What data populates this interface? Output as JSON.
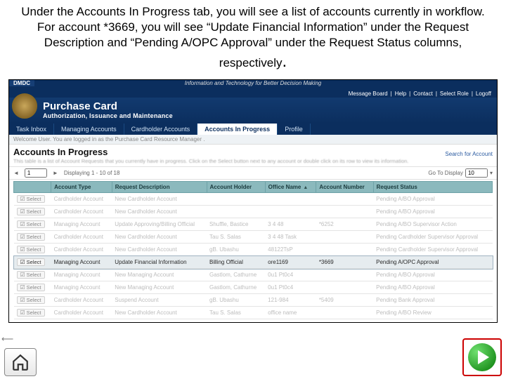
{
  "caption_html": "Under the Accounts In Progress tab, you will see a list of accounts currently in workflow. For account *3669, you will see “Update Financial Information” under the Request Description and “Pending A/OPC Approval” under the Request Status columns, respectively",
  "dmdc": {
    "tag": "DMDC",
    "center": "Information and Technology for Better Decision Making"
  },
  "util": {
    "items": [
      "Message Board",
      "Help",
      "Contact",
      "Select Role",
      "Logoff"
    ],
    "sep": "|"
  },
  "banner": {
    "title": "Purchase Card",
    "sub": "Authorization, Issuance and Maintenance"
  },
  "tabs": [
    "Task Inbox",
    "Managing Accounts",
    "Cardholder Accounts",
    "Accounts In Progress",
    "Profile"
  ],
  "active_tab_index": 3,
  "welcome": "Welcome User.  You are logged in as the Purchase Card Resource Manager .",
  "page_title": "Accounts In Progress",
  "search_link": "Search for Account",
  "instructions": "This table is a list of Account Requests that you currently have in progress.  Click on the Select button next to any account or double click on its row to view its information.",
  "toolbar": {
    "page_field": "1",
    "displaying": "Displaying 1 - 10 of 18",
    "go": "Go To Display",
    "count": "10"
  },
  "columns": [
    "",
    "Account Type",
    "Request Description",
    "Account Holder",
    "Office Name",
    "Account Number",
    "Request Status"
  ],
  "sort_col_index": 4,
  "select_label": "Select",
  "rows": [
    {
      "hl": false,
      "cells": [
        "Cardholder Account",
        "New Cardholder Account",
        "",
        "",
        "",
        "Pending A/BO Approval"
      ]
    },
    {
      "hl": false,
      "cells": [
        "Cardholder Account",
        "New Cardholder Account",
        "",
        "",
        "",
        "Pending A/BO Approval"
      ]
    },
    {
      "hl": false,
      "cells": [
        "Managing Account",
        "Update Approving/Billing Official",
        "Shuffle, Bastice",
        "3 4 48",
        "*6252",
        "Pending A/BO Supervisor Action"
      ]
    },
    {
      "hl": false,
      "cells": [
        "Cardholder Account",
        "New Cardholder Account",
        "Tau S. Salas",
        "3 4 48 Task",
        "",
        "Pending Cardholder Supervisor Approval"
      ]
    },
    {
      "hl": false,
      "cells": [
        "Cardholder Account",
        "New Cardholder Account",
        "gB. Ubashu",
        "48122TsP",
        "",
        "Pending Cardholder Supervisor Approval"
      ]
    },
    {
      "hl": true,
      "cells": [
        "Managing Account",
        "Update Financial Information",
        "Billing Official",
        "ore1169",
        "*3669",
        "Pending A/OPC Approval"
      ]
    },
    {
      "hl": false,
      "cells": [
        "Managing Account",
        "New Managing Account",
        "Gastlom, Cathurne",
        "0u1 Pt0c4",
        "",
        "Pending A/BO Approval"
      ]
    },
    {
      "hl": false,
      "cells": [
        "Managing Account",
        "New Managing Account",
        "Gastlom, Cathurne",
        "0u1 Pt0c4",
        "",
        "Pending A/BO Approval"
      ]
    },
    {
      "hl": false,
      "cells": [
        "Cardholder Account",
        "Suspend Account",
        "gB. Ubashu",
        "121-984",
        "*5409",
        "Pending Bank Approval"
      ]
    },
    {
      "hl": false,
      "cells": [
        "Cardholder Account",
        "New Cardholder Account",
        "Tau S. Salas",
        "office name",
        "",
        "Pending A/BO Review"
      ]
    }
  ]
}
